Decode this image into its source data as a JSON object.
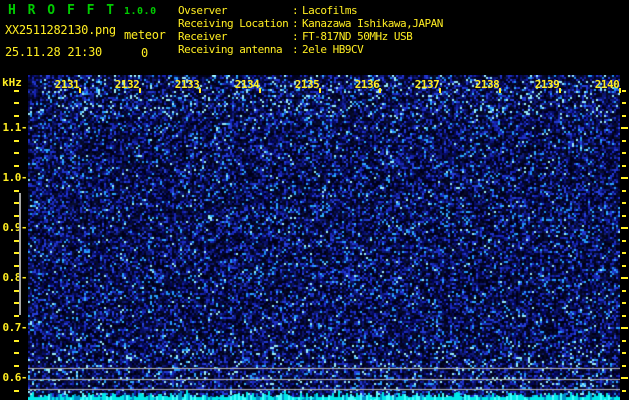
{
  "header": {
    "app_name": "H R O F F T",
    "version": "1.0.0",
    "filename": "XX2511282130.png",
    "event_label": "meteor",
    "event_count": "0",
    "datetime": "25.11.28 21:30",
    "colon_separator": ":",
    "info_rows": [
      {
        "label": "Ovserver",
        "value": "Lacofilms"
      },
      {
        "label": "Receiving Location",
        "value": "Kanazawa Ishikawa,JAPAN"
      },
      {
        "label": "Receiver",
        "value": "FT-817ND 50MHz USB"
      },
      {
        "label": "Receiving antenna",
        "value": "2ele HB9CV"
      }
    ]
  },
  "spectrogram": {
    "unit_label": "kHz",
    "time_labels": [
      "2131",
      "2132",
      "2133",
      "2134",
      "2135",
      "2136",
      "2137",
      "2138",
      "2139",
      "2140"
    ],
    "freq_tick_labels": [
      "1.1",
      "1.0",
      "0.9",
      "0.8",
      "0.7",
      "0.6"
    ],
    "freq_axis_range_khz": [
      0.56,
      1.18
    ],
    "reference_lines_khz": [
      0.62,
      0.6,
      0.58
    ],
    "meteor_echoes_visible": 0,
    "noise_floor_color": "#00e8e8",
    "reference_line_color": "#b4b4b4",
    "level_bar_color": "#a8a8a8",
    "noise_palette": [
      {
        "p": 0.5,
        "rgb": [
          0,
          0,
          28
        ],
        "jitter": 30
      },
      {
        "p": 0.25,
        "rgb": [
          6,
          10,
          95
        ],
        "jitter": 45
      },
      {
        "p": 0.175,
        "rgb": [
          25,
          40,
          185
        ],
        "jitter": 60
      },
      {
        "p": 0.06,
        "rgb": [
          35,
          150,
          255
        ],
        "jitter": 60
      },
      {
        "p": 0.015,
        "rgb": [
          150,
          235,
          255
        ],
        "jitter": 20
      }
    ]
  },
  "colors": {
    "title_green": "#00cc00",
    "text_yellow": "#ffee22",
    "background": "#000000"
  }
}
